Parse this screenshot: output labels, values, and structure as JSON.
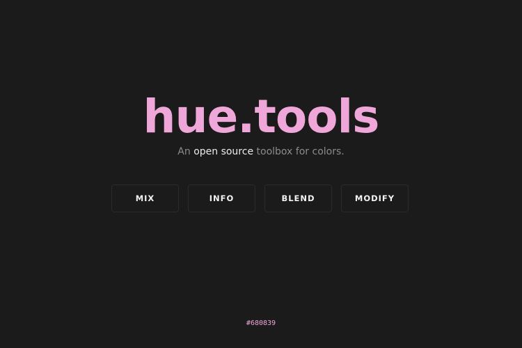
{
  "header": {
    "title": "hue.tools"
  },
  "tagline": {
    "prefix": "An ",
    "link": "open source",
    "suffix": " toolbox for colors."
  },
  "nav": {
    "mix": "MIX",
    "info": "INFO",
    "blend": "BLEND",
    "modify": "MODIFY"
  },
  "footer": {
    "hex": "#680839"
  },
  "colors": {
    "background": "#1b1b1b",
    "accent": "#efa7d9",
    "button_border": "#2b2b2b",
    "muted_text": "#8c8c8c",
    "bright_text": "#ececec"
  }
}
